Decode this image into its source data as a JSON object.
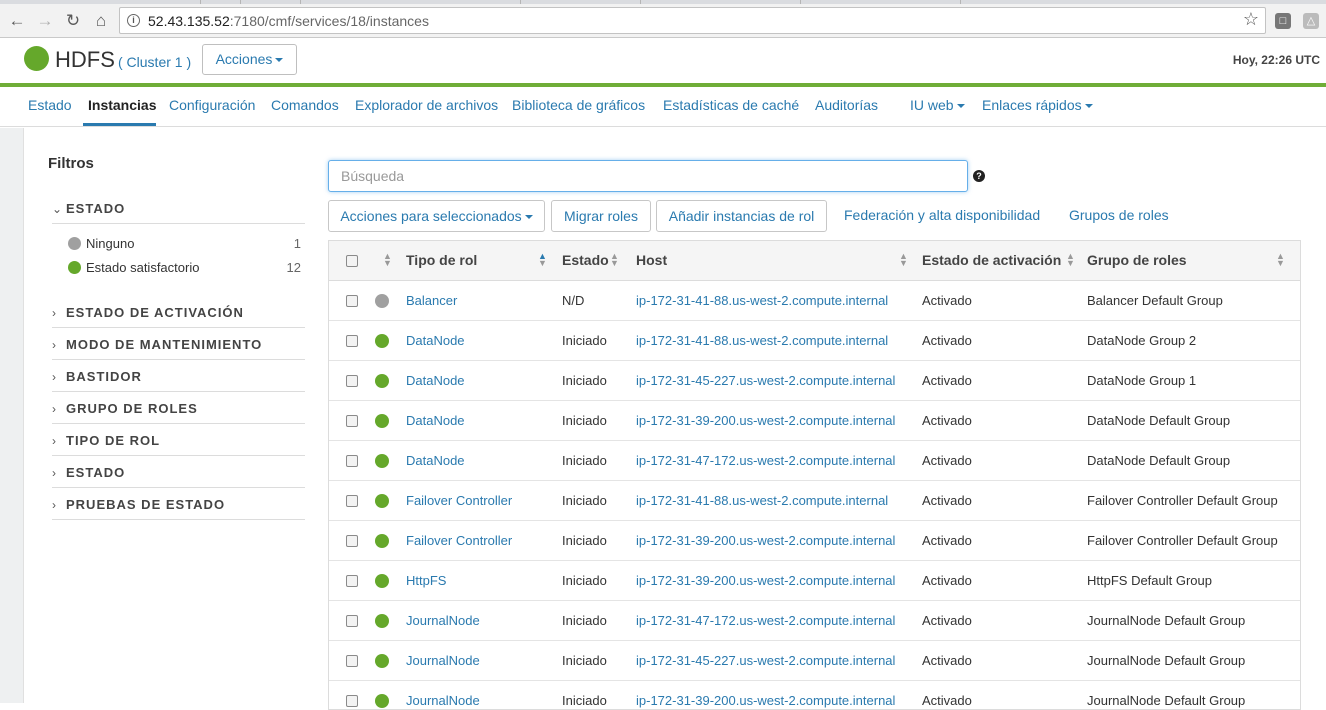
{
  "browser": {
    "url_host": "52.43.135.52",
    "url_path": ":7180/cmf/services/18/instances"
  },
  "header": {
    "service_name": "HDFS",
    "cluster": "( Cluster 1 )",
    "actions_label": "Acciones",
    "clock": "Hoy, 22:26 UTC"
  },
  "tabs": [
    {
      "label": "Estado"
    },
    {
      "label": "Instancias"
    },
    {
      "label": "Configuración"
    },
    {
      "label": "Comandos"
    },
    {
      "label": "Explorador de archivos"
    },
    {
      "label": "Biblioteca de gráficos"
    },
    {
      "label": "Estadísticas de caché"
    },
    {
      "label": "Auditorías"
    },
    {
      "label": "IU web"
    },
    {
      "label": "Enlaces rápidos"
    }
  ],
  "filters": {
    "title": "Filtros",
    "estado_group": "ESTADO",
    "items": [
      {
        "label": "Ninguno",
        "count": "1"
      },
      {
        "label": "Estado satisfactorio",
        "count": "12"
      }
    ],
    "groups": [
      "ESTADO DE ACTIVACIÓN",
      "MODO DE MANTENIMIENTO",
      "BASTIDOR",
      "GRUPO DE ROLES",
      "TIPO DE ROL",
      "ESTADO",
      "PRUEBAS DE ESTADO"
    ]
  },
  "search": {
    "placeholder": "Búsqueda"
  },
  "toolbar": {
    "bulk_actions": "Acciones para seleccionados",
    "migrate": "Migrar roles",
    "add_instances": "Añadir instancias de rol",
    "federation": "Federación y alta disponibilidad",
    "role_groups": "Grupos de roles"
  },
  "table": {
    "headers": {
      "role_type": "Tipo de rol",
      "state": "Estado",
      "host": "Host",
      "commission": "Estado de activación",
      "role_group": "Grupo de roles"
    },
    "rows": [
      {
        "role": "Balancer",
        "state": "N/D",
        "host": "ip-172-31-41-88.us-west-2.compute.internal",
        "commission": "Activado",
        "group": "Balancer Default Group",
        "health": "none"
      },
      {
        "role": "DataNode",
        "state": "Iniciado",
        "host": "ip-172-31-41-88.us-west-2.compute.internal",
        "commission": "Activado",
        "group": "DataNode Group 2",
        "health": "good"
      },
      {
        "role": "DataNode",
        "state": "Iniciado",
        "host": "ip-172-31-45-227.us-west-2.compute.internal",
        "commission": "Activado",
        "group": "DataNode Group 1",
        "health": "good"
      },
      {
        "role": "DataNode",
        "state": "Iniciado",
        "host": "ip-172-31-39-200.us-west-2.compute.internal",
        "commission": "Activado",
        "group": "DataNode Default Group",
        "health": "good"
      },
      {
        "role": "DataNode",
        "state": "Iniciado",
        "host": "ip-172-31-47-172.us-west-2.compute.internal",
        "commission": "Activado",
        "group": "DataNode Default Group",
        "health": "good"
      },
      {
        "role": "Failover Controller",
        "state": "Iniciado",
        "host": "ip-172-31-41-88.us-west-2.compute.internal",
        "commission": "Activado",
        "group": "Failover Controller Default Group",
        "health": "good"
      },
      {
        "role": "Failover Controller",
        "state": "Iniciado",
        "host": "ip-172-31-39-200.us-west-2.compute.internal",
        "commission": "Activado",
        "group": "Failover Controller Default Group",
        "health": "good"
      },
      {
        "role": "HttpFS",
        "state": "Iniciado",
        "host": "ip-172-31-39-200.us-west-2.compute.internal",
        "commission": "Activado",
        "group": "HttpFS Default Group",
        "health": "good"
      },
      {
        "role": "JournalNode",
        "state": "Iniciado",
        "host": "ip-172-31-47-172.us-west-2.compute.internal",
        "commission": "Activado",
        "group": "JournalNode Default Group",
        "health": "good"
      },
      {
        "role": "JournalNode",
        "state": "Iniciado",
        "host": "ip-172-31-45-227.us-west-2.compute.internal",
        "commission": "Activado",
        "group": "JournalNode Default Group",
        "health": "good"
      },
      {
        "role": "JournalNode",
        "state": "Iniciado",
        "host": "ip-172-31-39-200.us-west-2.compute.internal",
        "commission": "Activado",
        "group": "JournalNode Default Group",
        "health": "good"
      }
    ]
  },
  "colors": {
    "good": "#65a82b",
    "none": "#a0a0a0",
    "link": "#2a7aaf",
    "accent_rule": "#6fad37"
  }
}
